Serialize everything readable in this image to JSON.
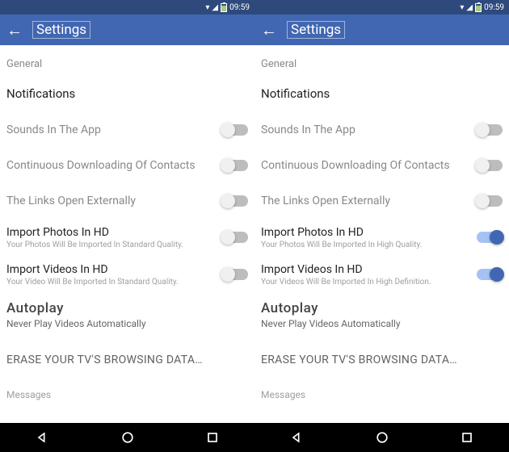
{
  "colors": {
    "brand": "#4267b2",
    "status_bg": "#2e4a7d"
  },
  "status": {
    "time": "09:59"
  },
  "header": {
    "title": "Settings"
  },
  "left": {
    "general_label": "General",
    "notifications_label": "Notifications",
    "rows": {
      "sounds": {
        "title": "Sounds In The App",
        "on": false
      },
      "contacts": {
        "title": "Continuous Downloading Of Contacts",
        "on": false
      },
      "links": {
        "title": "The Links Open Externally",
        "on": false
      },
      "photos": {
        "title": "Import Photos In HD",
        "sub": "Your Photos Will Be Imported In Standard Quality.",
        "on": false
      },
      "videos": {
        "title": "Import Videos In HD",
        "sub": "Your Video Will Be Imported In Standard Quality.",
        "on": false
      },
      "autoplay": {
        "title": "Autoplay",
        "sub": "Never Play Videos Automatically"
      },
      "erase": "ERASE YOUR TV'S BROWSING DATA…",
      "messages": "Messages"
    }
  },
  "right": {
    "general_label": "General",
    "notifications_label": "Notifications",
    "rows": {
      "sounds": {
        "title": "Sounds In The App",
        "on": false
      },
      "contacts": {
        "title": "Continuous Downloading Of Contacts",
        "on": false
      },
      "links": {
        "title": "The Links Open Externally",
        "on": false
      },
      "photos": {
        "title": "Import Photos In HD",
        "sub": "Your Photos Will Be Imported In High Quality.",
        "on": true
      },
      "videos": {
        "title": "Import Videos In HD",
        "sub": "Your Videos Will Be Imported In High Definition.",
        "on": true
      },
      "autoplay": {
        "title": "Autoplay",
        "sub": "Never Play Videos Automatically"
      },
      "erase": "ERASE YOUR TV'S BROWSING DATA…",
      "messages": "Messages"
    }
  }
}
